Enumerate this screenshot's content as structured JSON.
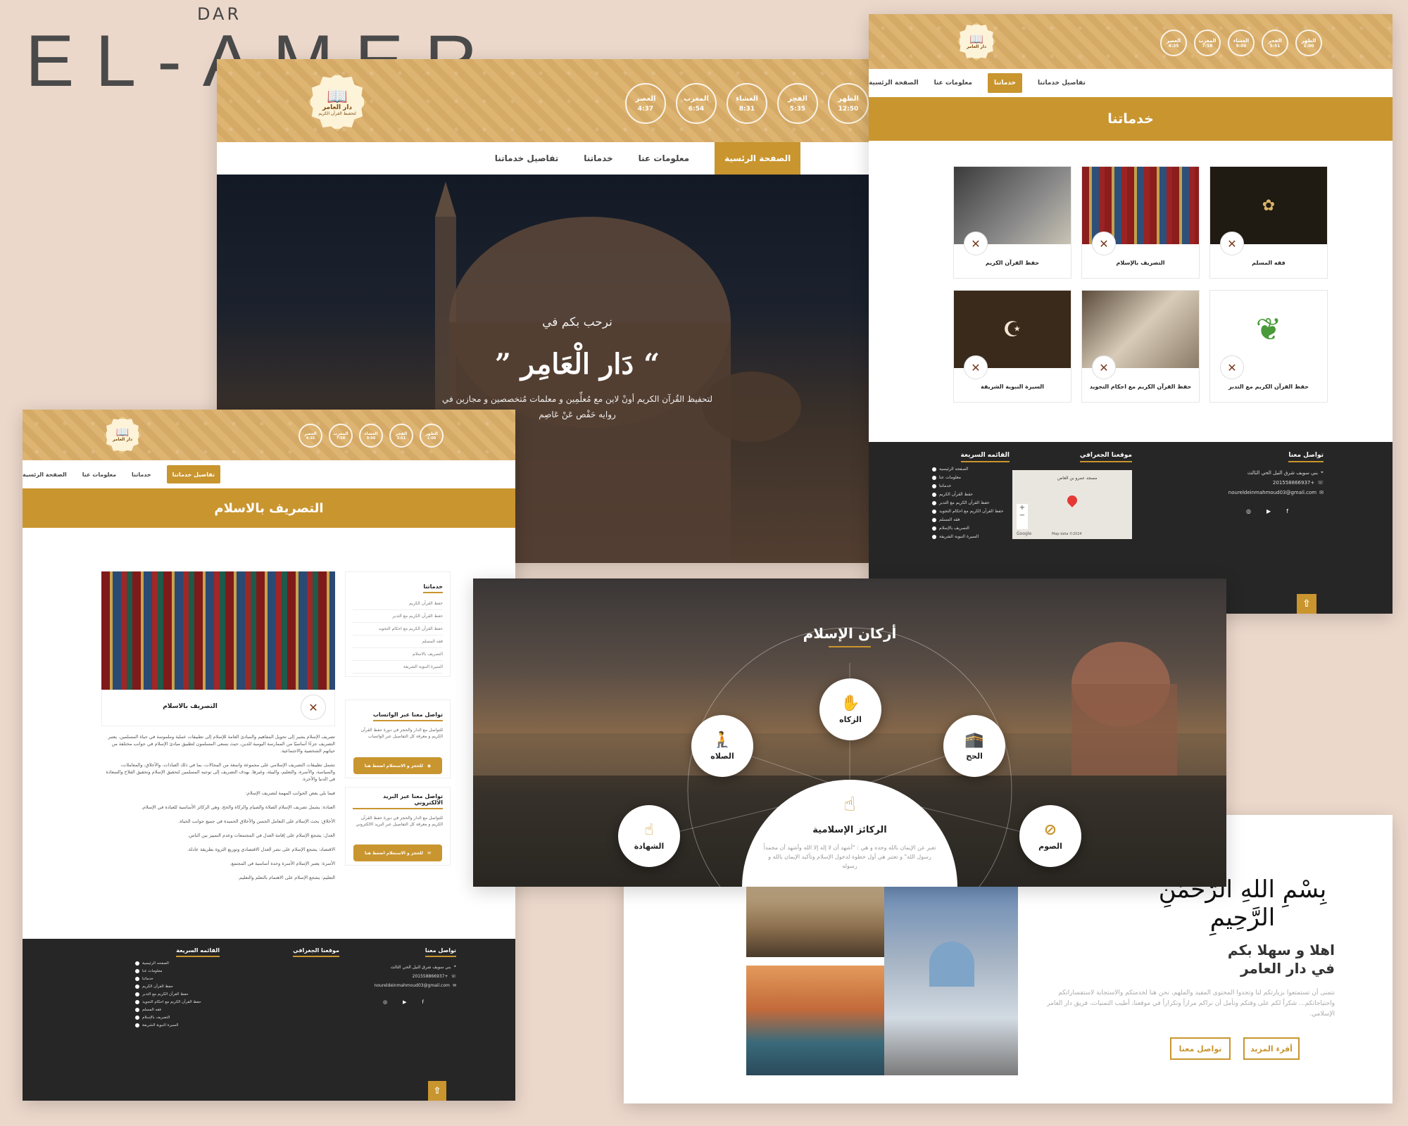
{
  "brand": {
    "small": "DAR",
    "big": "EL-AMER"
  },
  "logo": {
    "title": "دار العامر",
    "subtitle": "لتحفيظ القرآن الكريم"
  },
  "prayers": [
    {
      "name": "الظهر",
      "time": "12:50"
    },
    {
      "name": "الفجر",
      "time": "5:35"
    },
    {
      "name": "العشاء",
      "time": "8:31"
    },
    {
      "name": "المغرب",
      "time": "6:54"
    },
    {
      "name": "العصر",
      "time": "4:37"
    }
  ],
  "prayers_small": [
    {
      "name": "الظهر",
      "time": "1:00"
    },
    {
      "name": "الفجر",
      "time": "5:51"
    },
    {
      "name": "العشاء",
      "time": "9:00"
    },
    {
      "name": "المغرب",
      "time": "7:58"
    },
    {
      "name": "العصر",
      "time": "4:35"
    }
  ],
  "nav": {
    "home": "الصفحة الرئسية",
    "about": "معلومات عنا",
    "services": "خدماتنا",
    "details": "تفاصيل خدماتنا"
  },
  "hero": {
    "welcome": "نرحب بكم في",
    "title": "“ دَار الْعَامِر ”",
    "desc1": "لتحفيظ القُرآن الكريم أونْ لاين مع مُعلِّمِين و معلمات مُتخصصين و مجازين في",
    "desc2": "روايه حَفْص عَنْ عَاصِم"
  },
  "services_page": {
    "title": "خدماتنا",
    "cards": [
      {
        "label": "حفظ القرآن الكريم"
      },
      {
        "label": "التصريف بالإسلام"
      },
      {
        "label": "فقه المسلم"
      },
      {
        "label": "السيرة النبوية الشريفة"
      },
      {
        "label": "حفظ القرآن الكريم مع احكام التجويد"
      },
      {
        "label": "حفظ القرآن الكريم مع التدبر"
      }
    ]
  },
  "footer": {
    "contact_title": "تواصل معنا",
    "address": "بني سويف شرق النيل الحي الثالث",
    "phone": "+201558866937",
    "email": "noureldeinmahmoud03@gmail.com",
    "location_title": "موقعنا الجغرافي",
    "map_place": "مسجد عمرو بن العاص",
    "map_label": "Google",
    "map_data": "Map data ©2024",
    "quick_title": "القائمه السريعة",
    "quick_links": [
      "الصفحه الرئيسية",
      "معلومات عنا",
      "خدماتنا",
      "حفظ القرآن الكريم",
      "حفظ القرآن الكريم مع التدبر",
      "حفظ القرآن الكريم مع احكام التجويد",
      "فقه المسلم",
      "التصريف بالإسلام",
      "السيرة النبوية الشريفة"
    ],
    "social": [
      "f",
      "▶",
      "◎"
    ],
    "scroll_top": "⇧"
  },
  "detail_page": {
    "title": "التصريف بالاسلام",
    "card_caption": "التصريف بالاسلام",
    "sidebar_title": "خدماتنا",
    "sidebar_items": [
      "حفظ القرآن الكريم",
      "حفظ القرآن الكريم مع التدبر",
      "حفظ القرآن الكريم مع احكام التجويد",
      "فقه المسلم",
      "التصريف بالاسلام",
      "السيرة النبوية الشريفة"
    ],
    "whatsapp_title": "تواصل معنا عبر الواتساب",
    "whatsapp_text": "للتواصل مع الدار والحجز في دورة حفظ القرآن الكريم و معرفة كل التفاصيل عبر الواتساب",
    "whatsapp_btn": "للحجز و الاستعلام اضغط هنا",
    "email_title": "تواصل معنا عبر البريد الالكتروني",
    "email_text": "للتواصل مع الدار والحجز في دورة حفظ القرآن الكريم و معرفة كل التفاصيل عبر البريد الالكتروني",
    "email_btn": "للحجز و الاستعلام اضغط هنا",
    "paragraphs": [
      "تصريف الإسلام يشير إلى تحويل المفاهيم والمبادئ العامة للإسلام إلى تطبيقات عملية وملموسة في حياة المسلمين. يعتبر التصريف جزءًا أساسيًا من الممارسة اليومية للدين، حيث يسعى المسلمون لتطبيق مبادئ الإسلام في جوانب مختلفة من حياتهم الشخصية والاجتماعية.",
      "تشمل تطبيقات التصريف الإسلامي على مجموعة واسعة من المجالات، بما في ذلك العبادات، والأخلاق، والمعاملات، والسياسة، والأسرة، والتعليم، والبيئة، وغيرها. يهدف التصريف إلى توجيه المسلمين لتحقيق الإسلام وتحقيق الفلاح والسعادة في الدنيا والآخرة.",
      "فيما يلي بعض الجوانب المهمة لتصريف الإسلام:",
      "العبادة: يشمل تصريف الإسلام الصلاة والصيام والزكاة والحج، وهي الركائز الأساسية للعبادة في الإسلام.",
      "الأخلاق: يحث الإسلام على التعامل الحسن والأخلاق الحميدة في جميع جوانب الحياة.",
      "العدل: يشجع الإسلام على إقامة العدل في المجتمعات وعدم التمييز بين الناس.",
      "الاقتصاد: يشجع الإسلام على نشر العدل الاقتصادي وتوزيع الثروة بطريقة عادلة.",
      "الأسرة: يعتبر الإسلام الأسرة وحدة أساسية في المجتمع.",
      "التعليم: يشجع الإسلام على الاهتمام بالتعلم والتعليم."
    ]
  },
  "pillars": {
    "title": "أركان الإسلام",
    "center_title": "الركائز الإسلامية",
    "center_text": "تعبر عن الإيمان بالله وحده و هي : \"أشهد أن لا إله إلا الله وأشهد أن محمداً رسول الله\" و تعتبر هي أول خطوة لدخول الإسلام وتأكيد الإيمان بالله و رسوله",
    "items": [
      {
        "name": "الزكاه",
        "icon": "✋"
      },
      {
        "name": "الصلاه",
        "icon": "🧎"
      },
      {
        "name": "الحج",
        "icon": "🕋"
      },
      {
        "name": "الشهادة",
        "icon": "☝"
      },
      {
        "name": "الصوم",
        "icon": "⊘"
      }
    ],
    "center_icon": "☝"
  },
  "welcome": {
    "basmala": "بِسْمِ اللهِ الرَّحْمَنِ الرَّحِيمِ",
    "title1": "اهلا و سهلا بكم",
    "title2": "في دار العامر",
    "text": "نتمنى أن تستمتعوا بزيارتكم لنا وتجدوا المحتوى المفيد والملهم، نحن هنا لخدمتكم والاستجابة لاستفساراتكم واحتياجاتكم... شكراً لكم على وقتكم ونأمل أن نراكم مراراً وتكراراً في موقعنا، أطيب التمنيات، فريق دار العامر الإسلامي.",
    "btn_more": "أقرء المزيد",
    "btn_contact": "تواصل معنا"
  }
}
